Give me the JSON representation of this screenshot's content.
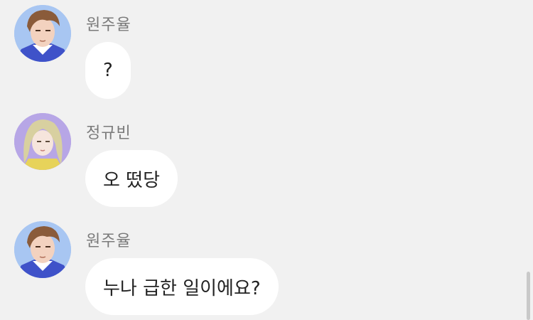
{
  "colors": {
    "background": "#f1f1f1",
    "bubble": "#ffffff",
    "name_text": "#7a7a7a",
    "message_text": "#222222",
    "avatar_juyul_bg": "#a8c6f2",
    "avatar_gyubin_bg": "#b7a6e6"
  },
  "messages": [
    {
      "sender": "원주율",
      "text": "?",
      "avatar": "male-character-avatar"
    },
    {
      "sender": "정규빈",
      "text": "오 떴당",
      "avatar": "female-character-avatar"
    },
    {
      "sender": "원주율",
      "text": "누나 급한 일이에요?",
      "avatar": "male-character-avatar"
    }
  ]
}
